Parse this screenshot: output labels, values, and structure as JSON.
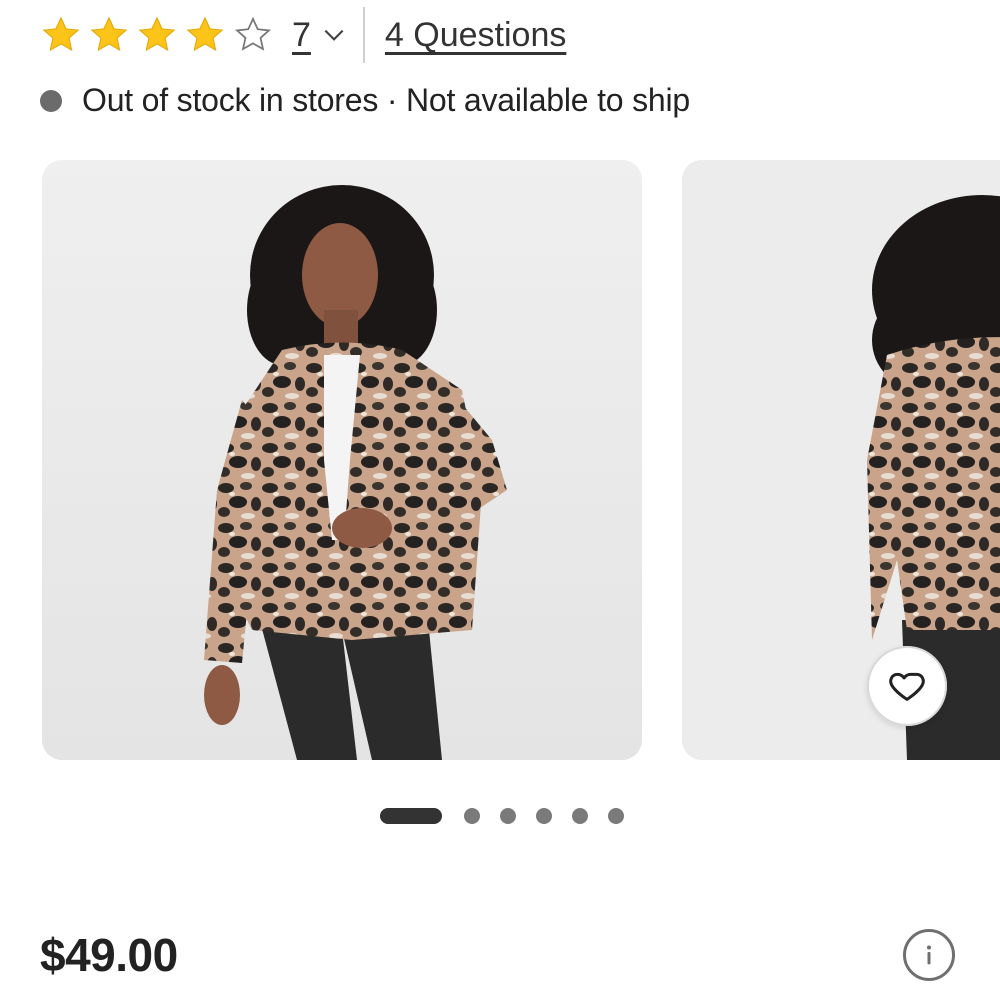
{
  "rating": {
    "stars_filled": 4,
    "stars_total": 5,
    "review_count": "7",
    "questions_link": "4 Questions",
    "star_color": "#FCC419",
    "empty_star_color": "#777777"
  },
  "stock": {
    "status_text": "Out of stock in stores · Not available to ship",
    "dot_color": "#6b6b6b"
  },
  "carousel": {
    "images": [
      {
        "icon": "product-photo-front",
        "description_icon": "leopard-jacket-front"
      },
      {
        "icon": "product-photo-back",
        "description_icon": "leopard-jacket-back"
      }
    ],
    "page_count": 6,
    "active_index": 0,
    "favorite_icon": "heart-icon"
  },
  "price": {
    "value": "$49.00"
  },
  "info_icon": "info-icon",
  "colors": {
    "text": "#222222",
    "card_bg": "#ededed"
  }
}
